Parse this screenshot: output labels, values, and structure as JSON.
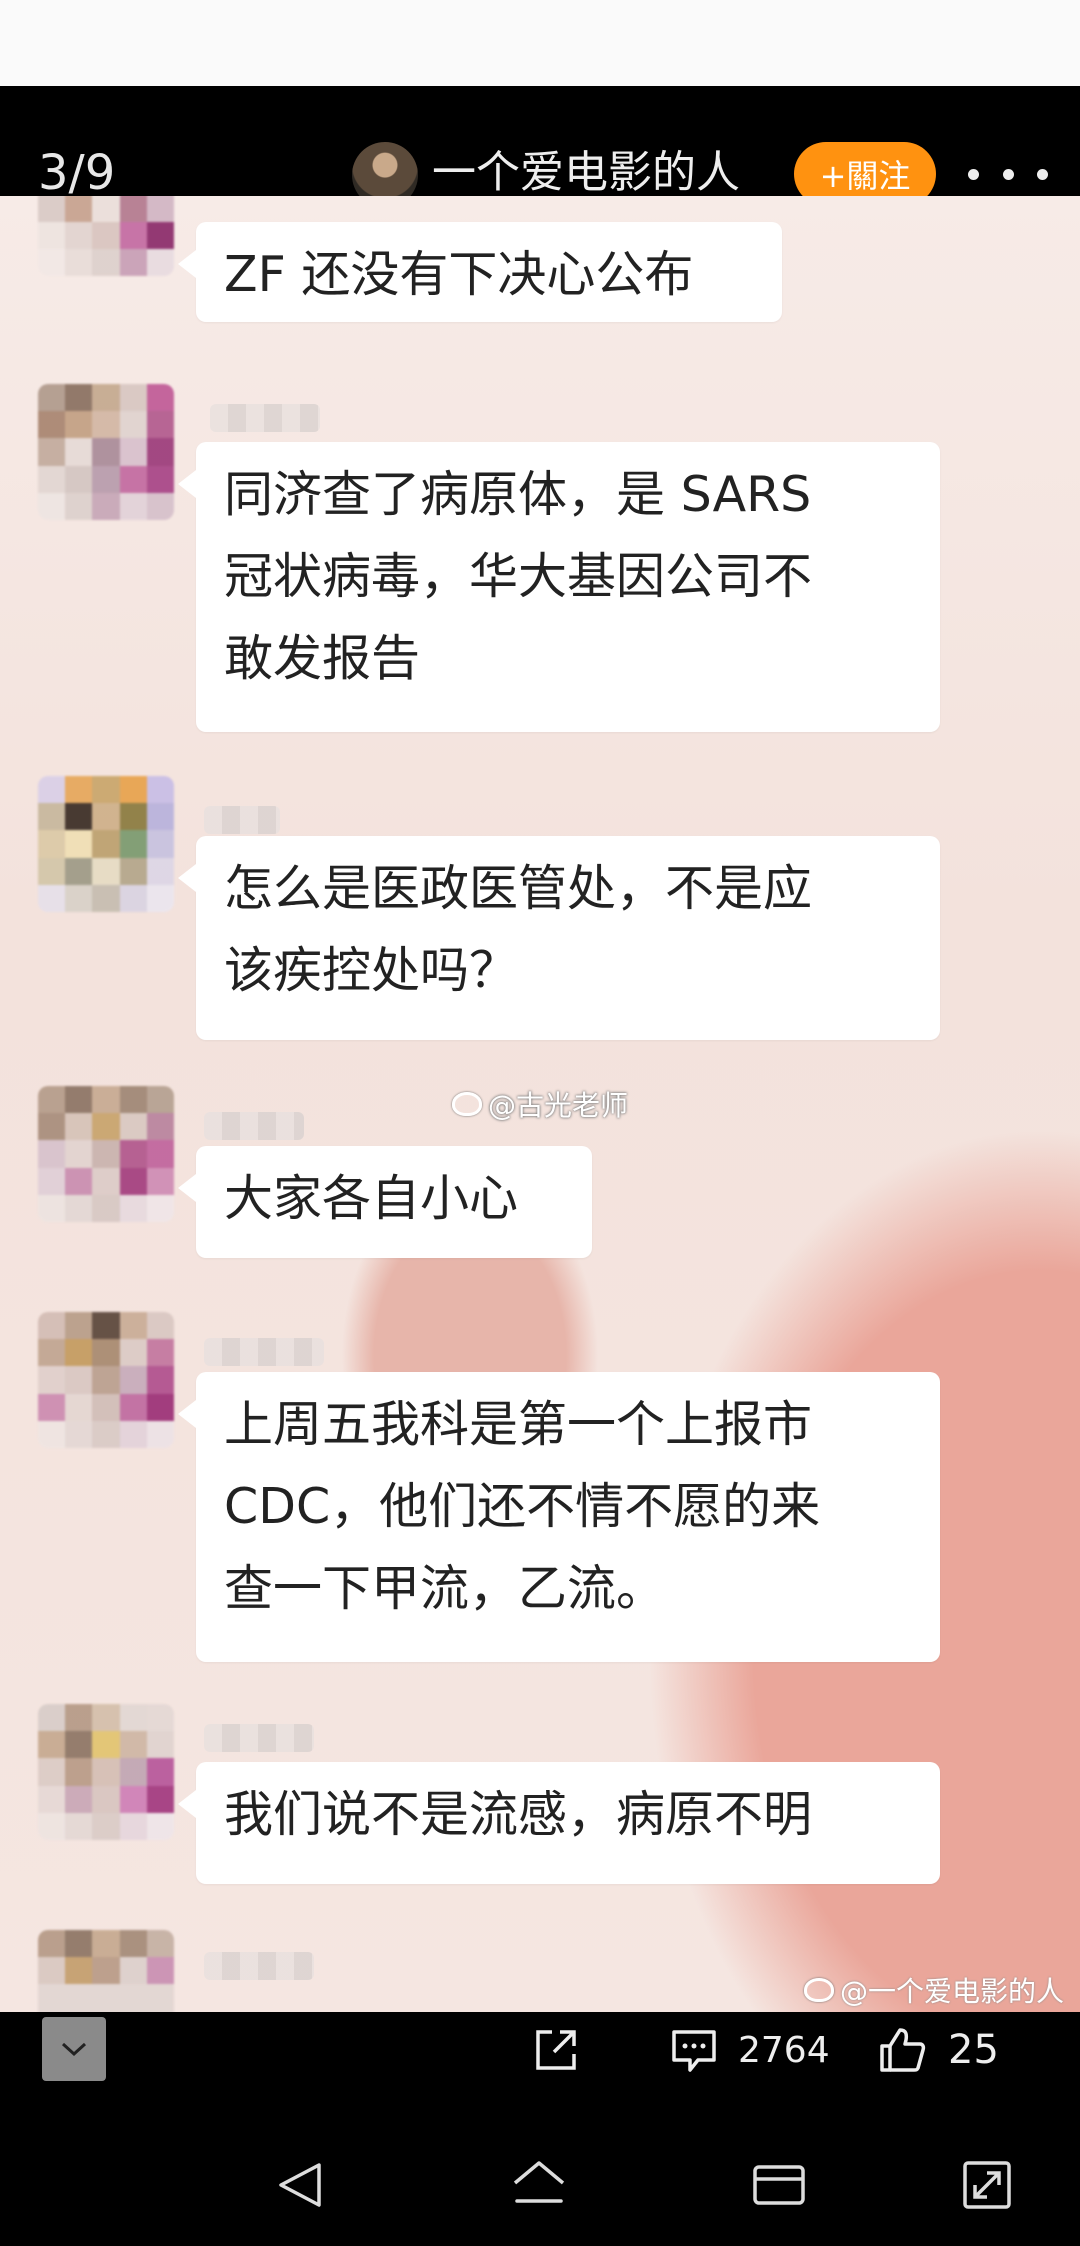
{
  "header": {
    "page_counter": "3/9",
    "author_name": "一个爱电影的人",
    "follow_label": "+關注"
  },
  "chat": {
    "messages": [
      {
        "text": "ZF 还没有下决心公布"
      },
      {
        "text": "同济查了病原体，是 SARS\n冠状病毒，华大基因公司不\n敢发报告"
      },
      {
        "text": "怎么是医政医管处，不是应\n该疾控处吗？"
      },
      {
        "text": "大家各自小心"
      },
      {
        "text": "上周五我科是第一个上报市\nCDC，他们还不情不愿的来\n查一下甲流，乙流。"
      },
      {
        "text": "我们说不是流感，病原不明"
      }
    ],
    "watermark_center": "@古光老师",
    "watermark_corner": "@一个爱电影的人"
  },
  "actions": {
    "comment_count": "2764",
    "like_count": "25"
  },
  "colors": {
    "follow_button": "#ff9210",
    "bubble": "#ffffff",
    "background": "#000000"
  },
  "icons": [
    "chevron-down-icon",
    "share-icon",
    "comment-icon",
    "like-icon",
    "back-icon",
    "home-icon",
    "recents-icon",
    "fullscreen-icon"
  ]
}
